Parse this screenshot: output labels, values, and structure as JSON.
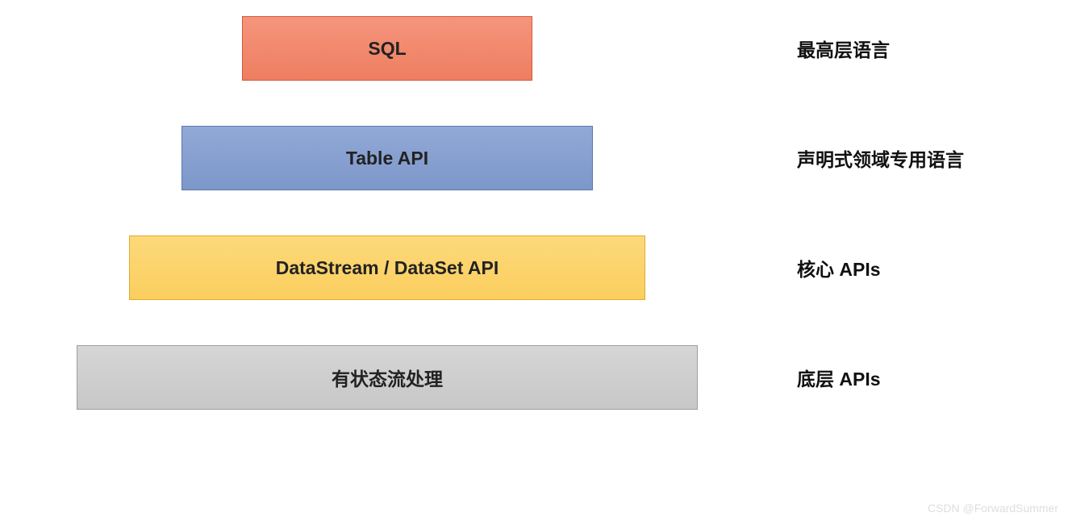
{
  "layers": [
    {
      "box_label": "SQL",
      "side_label": "最高层语言",
      "class": "b1"
    },
    {
      "box_label": "Table API",
      "side_label": "声明式领域专用语言",
      "class": "b2"
    },
    {
      "box_label": "DataStream / DataSet API",
      "side_label": "核心 APIs",
      "class": "b3"
    },
    {
      "box_label": "有状态流处理",
      "side_label": "底层 APIs",
      "class": "b4"
    }
  ],
  "watermark": "CSDN @ForwardSummer"
}
